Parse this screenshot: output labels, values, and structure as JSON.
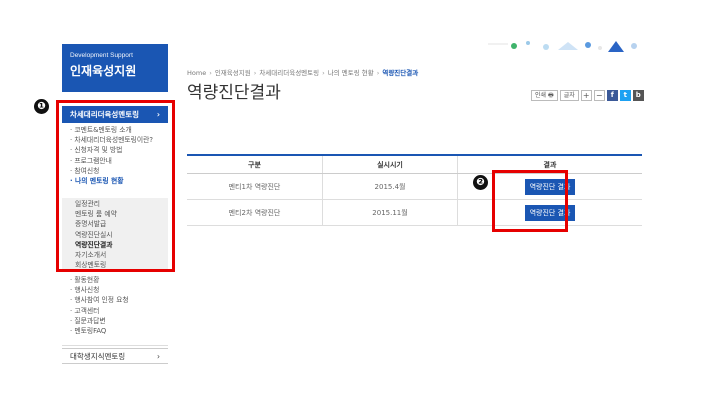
{
  "sidebar": {
    "header_en": "Development Support",
    "header_ko": "인재육성지원",
    "active_menu": "차세대리더육성멘토링",
    "active_arrow": "›",
    "sub1": [
      "· 코멘트&멘토링 소개",
      "· 차세대리더육성멘토링이란?",
      "· 신청자격 및 방법",
      "· 프로그램안내",
      "· 참여신청",
      "· 나의 멘토링 현황"
    ],
    "sub2": [
      "일정관리",
      "멘토링 룸 예약",
      "증명서발급",
      "역량진단실시",
      "역량진단결과",
      "자기소개서",
      "회상멘토링"
    ],
    "sub3": [
      "· 활동현황",
      "· 행사신청",
      "· 행사참여 인정 요청",
      "· 고객센터",
      "· 질문과답변",
      "· 멘토링FAQ"
    ],
    "bottom_menu": "대학생지식멘토링",
    "bottom_arrow": "›"
  },
  "breadcrumb": [
    "Home",
    "인재육성지원",
    "차세대리더육성멘토링",
    "나의 멘토링 현황",
    "역량진단결과"
  ],
  "breadcrumb_sep": "›",
  "page_title": "역량진단결과",
  "tools": {
    "print": "인쇄",
    "print_icon": "🖶",
    "font": "글자",
    "plus": "+",
    "minus": "−",
    "facebook": "f",
    "twitter": "t",
    "blog": "b"
  },
  "table": {
    "headers": [
      "구분",
      "실시시기",
      "결과"
    ],
    "rows": [
      {
        "type": "멘티1차 역량진단",
        "date": "2015.4월",
        "button": "역량진단 결과"
      },
      {
        "type": "멘티2차 역량진단",
        "date": "2015.11월",
        "button": "역량진단 결과"
      }
    ]
  },
  "annotations": {
    "badge1": "❶",
    "badge2": "❷"
  },
  "colors": {
    "primary": "#1a56b3",
    "annotation": "#e60000"
  }
}
